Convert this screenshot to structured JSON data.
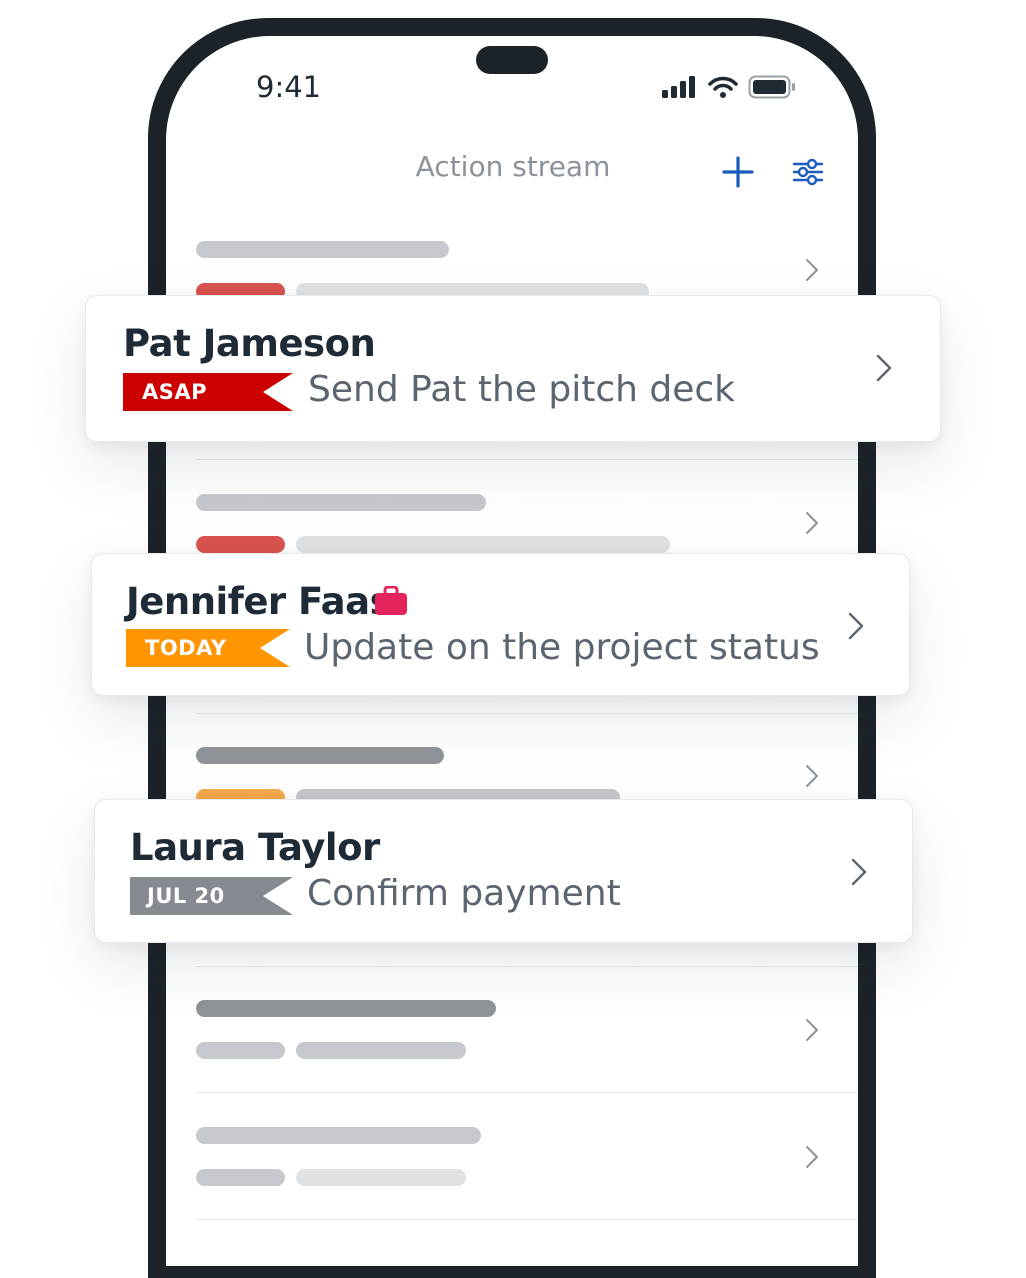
{
  "status_bar": {
    "time": "9:41",
    "icons": [
      "signal-icon",
      "wifi-icon",
      "battery-icon"
    ]
  },
  "nav": {
    "title": "Action stream",
    "add_icon": "plus-icon",
    "filter_icon": "sliders-icon"
  },
  "cards": [
    {
      "name": "Pat Jameson",
      "badge": "ASAP",
      "badge_color": "#cc0000",
      "task": "Send Pat the pitch deck"
    },
    {
      "name": "Jennifer Faas",
      "icon": "briefcase-icon",
      "icon_color": "#e3245a",
      "badge": "TODAY",
      "badge_color": "#ff9500",
      "task": "Update on the project status"
    },
    {
      "name": "Laura Taylor",
      "badge": "JUL 20",
      "badge_color": "#858b91",
      "task": "Confirm payment"
    }
  ],
  "colors": {
    "accent": "#1a5bbf",
    "phone_frame": "#1b2329"
  }
}
